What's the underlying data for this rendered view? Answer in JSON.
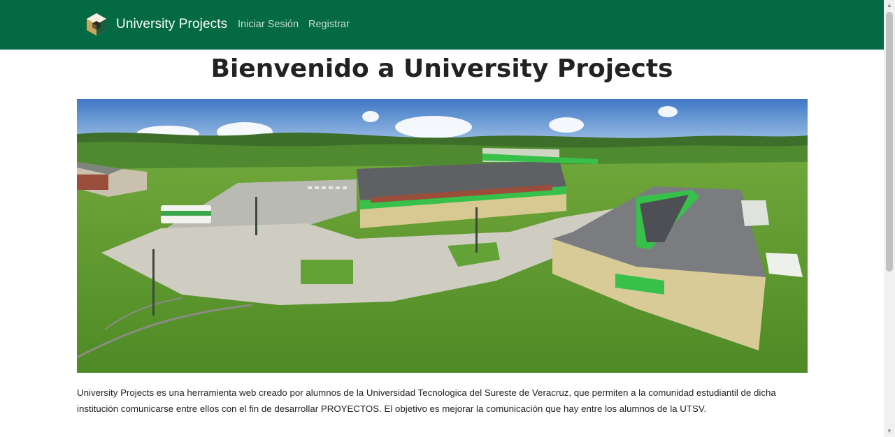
{
  "navbar": {
    "brand": "University Projects",
    "links": [
      {
        "label": "Iniciar Sesión"
      },
      {
        "label": "Registrar"
      }
    ],
    "background": "#046a43"
  },
  "main": {
    "title": "Bienvenido a University Projects",
    "description": "University Projects es una herramienta web creado por alumnos de la Universidad Tecnologica del Sureste de Veracruz, que permiten a la comunidad estudiantil de dicha institución comunicarse entre ellos con el fin de desarrollar PROYECTOS. El objetivo es mejorar la comunicación que hay entre los alumnos de la UTSV."
  },
  "hero_image": {
    "subject": "aerial-campus-photo"
  }
}
